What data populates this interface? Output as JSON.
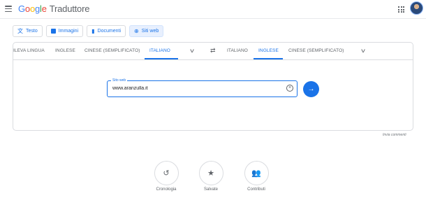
{
  "header": {
    "brand": "Google",
    "product": "Traduttore",
    "brand_colors": [
      "#4285f4",
      "#ea4335",
      "#fbbc05",
      "#4285f4",
      "#34a853",
      "#ea4335"
    ]
  },
  "modes": [
    {
      "label": "Testo",
      "icon": "translate-icon",
      "active": false
    },
    {
      "label": "Immagini",
      "icon": "image-icon",
      "active": false
    },
    {
      "label": "Documenti",
      "icon": "document-icon",
      "active": false
    },
    {
      "label": "Siti web",
      "icon": "globe-icon",
      "active": true
    }
  ],
  "source_langs": [
    "ILEVA LINGUA",
    "INGLESE",
    "CINESE (SEMPLIFICATO)",
    "ITALIANO"
  ],
  "source_selected": "ITALIANO",
  "target_langs": [
    "ITALIANO",
    "INGLESE",
    "CINESE (SEMPLIFICATO)"
  ],
  "target_selected": "INGLESE",
  "website": {
    "label": "Sito web",
    "value": "www.aranzulla.it"
  },
  "feedback": "Invia commenti",
  "bottom_actions": [
    {
      "label": "Cronologia",
      "icon": "history-icon"
    },
    {
      "label": "Salvate",
      "icon": "star-icon"
    },
    {
      "label": "Contributi",
      "icon": "people-icon"
    }
  ],
  "colors": {
    "accent": "#1a73e8",
    "active_bg": "#e8f0fe"
  }
}
